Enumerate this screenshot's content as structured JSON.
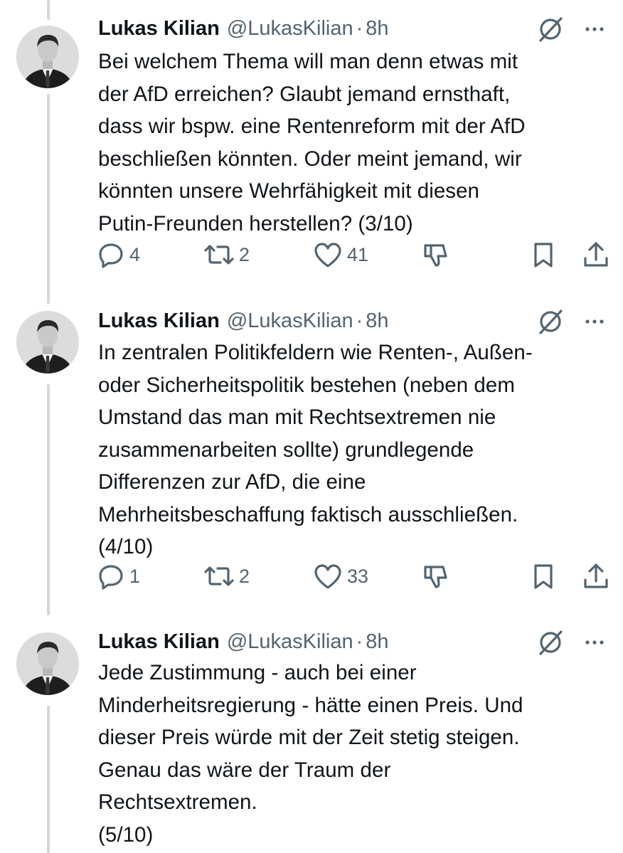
{
  "colors": {
    "text": "#0f1419",
    "secondary": "#536471",
    "thread_line": "#cfd9de",
    "background": "#ffffff"
  },
  "icons": [
    "reply-icon",
    "retweet-icon",
    "like-icon",
    "dislike-icon",
    "bookmark-icon",
    "share-icon",
    "grok-icon",
    "more-icon"
  ],
  "tweets": [
    {
      "author": {
        "name": "Lukas Kilian",
        "handle": "@LukasKilian",
        "separator": "·",
        "time": "8h"
      },
      "lines": [
        "Bei welchem Thema will man denn etwas mit",
        "der AfD erreichen? Glaubt jemand ernsthaft,",
        "dass wir bspw. eine Rentenreform mit der AfD",
        "beschließen könnten. Oder meint jemand, wir",
        "könnten unsere Wehrfähigkeit mit diesen",
        "Putin-Freunden herstellen? (3/10)"
      ],
      "stats": {
        "replies": "4",
        "reposts": "2",
        "likes": "41"
      }
    },
    {
      "author": {
        "name": "Lukas Kilian",
        "handle": "@LukasKilian",
        "separator": "·",
        "time": "8h"
      },
      "lines": [
        "In zentralen Politikfeldern wie Renten-, Außen-",
        "oder Sicherheitspolitik bestehen (neben dem",
        "Umstand das man mit Rechtsextremen nie",
        "zusammenarbeiten sollte) grundlegende",
        "Differenzen zur AfD, die eine",
        "Mehrheitsbeschaffung faktisch ausschließen.",
        "(4/10)"
      ],
      "stats": {
        "replies": "1",
        "reposts": "2",
        "likes": "33"
      }
    },
    {
      "author": {
        "name": "Lukas Kilian",
        "handle": "@LukasKilian",
        "separator": "·",
        "time": "8h"
      },
      "lines": [
        "Jede Zustimmung - auch bei einer",
        "Minderheitsregierung - hätte einen Preis. Und",
        "dieser Preis würde mit der Zeit stetig steigen.",
        "Genau das wäre der Traum der",
        "Rechtsextremen.",
        "(5/10)"
      ]
    }
  ]
}
